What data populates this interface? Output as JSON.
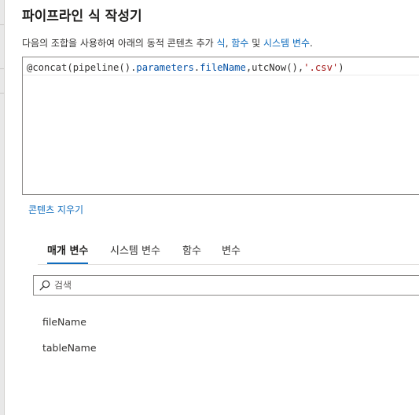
{
  "panel": {
    "title": "파이프라인 식 작성기",
    "description_prefix": "다음의 조합을 사용하여 아래의 동적 콘텐츠 추가 ",
    "link_expressions": "식",
    "sep1": ", ",
    "link_functions": "함수",
    "sep2": " 및 ",
    "link_system_variables": "시스템 변수",
    "description_suffix": "."
  },
  "editor": {
    "tokens": [
      {
        "text": "@concat(pipeline().",
        "kind": "fn"
      },
      {
        "text": "parameters",
        "kind": "param"
      },
      {
        "text": ".",
        "kind": "fn"
      },
      {
        "text": "fileName",
        "kind": "param"
      },
      {
        "text": ",utcNow(),",
        "kind": "fn"
      },
      {
        "text": "'.csv'",
        "kind": "str"
      },
      {
        "text": ")",
        "kind": "fn"
      }
    ]
  },
  "clear_content_label": "콘텐츠 지우기",
  "tabs": [
    {
      "label": "매개 변수",
      "active": true
    },
    {
      "label": "시스템 변수",
      "active": false
    },
    {
      "label": "함수",
      "active": false
    },
    {
      "label": "변수",
      "active": false
    }
  ],
  "search": {
    "placeholder": "검색",
    "value": "",
    "icon": "search-icon"
  },
  "parameters": [
    "fileName",
    "tableName"
  ],
  "colors": {
    "accent": "#0f6cbd",
    "text": "#323130",
    "border": "#8a8886"
  }
}
